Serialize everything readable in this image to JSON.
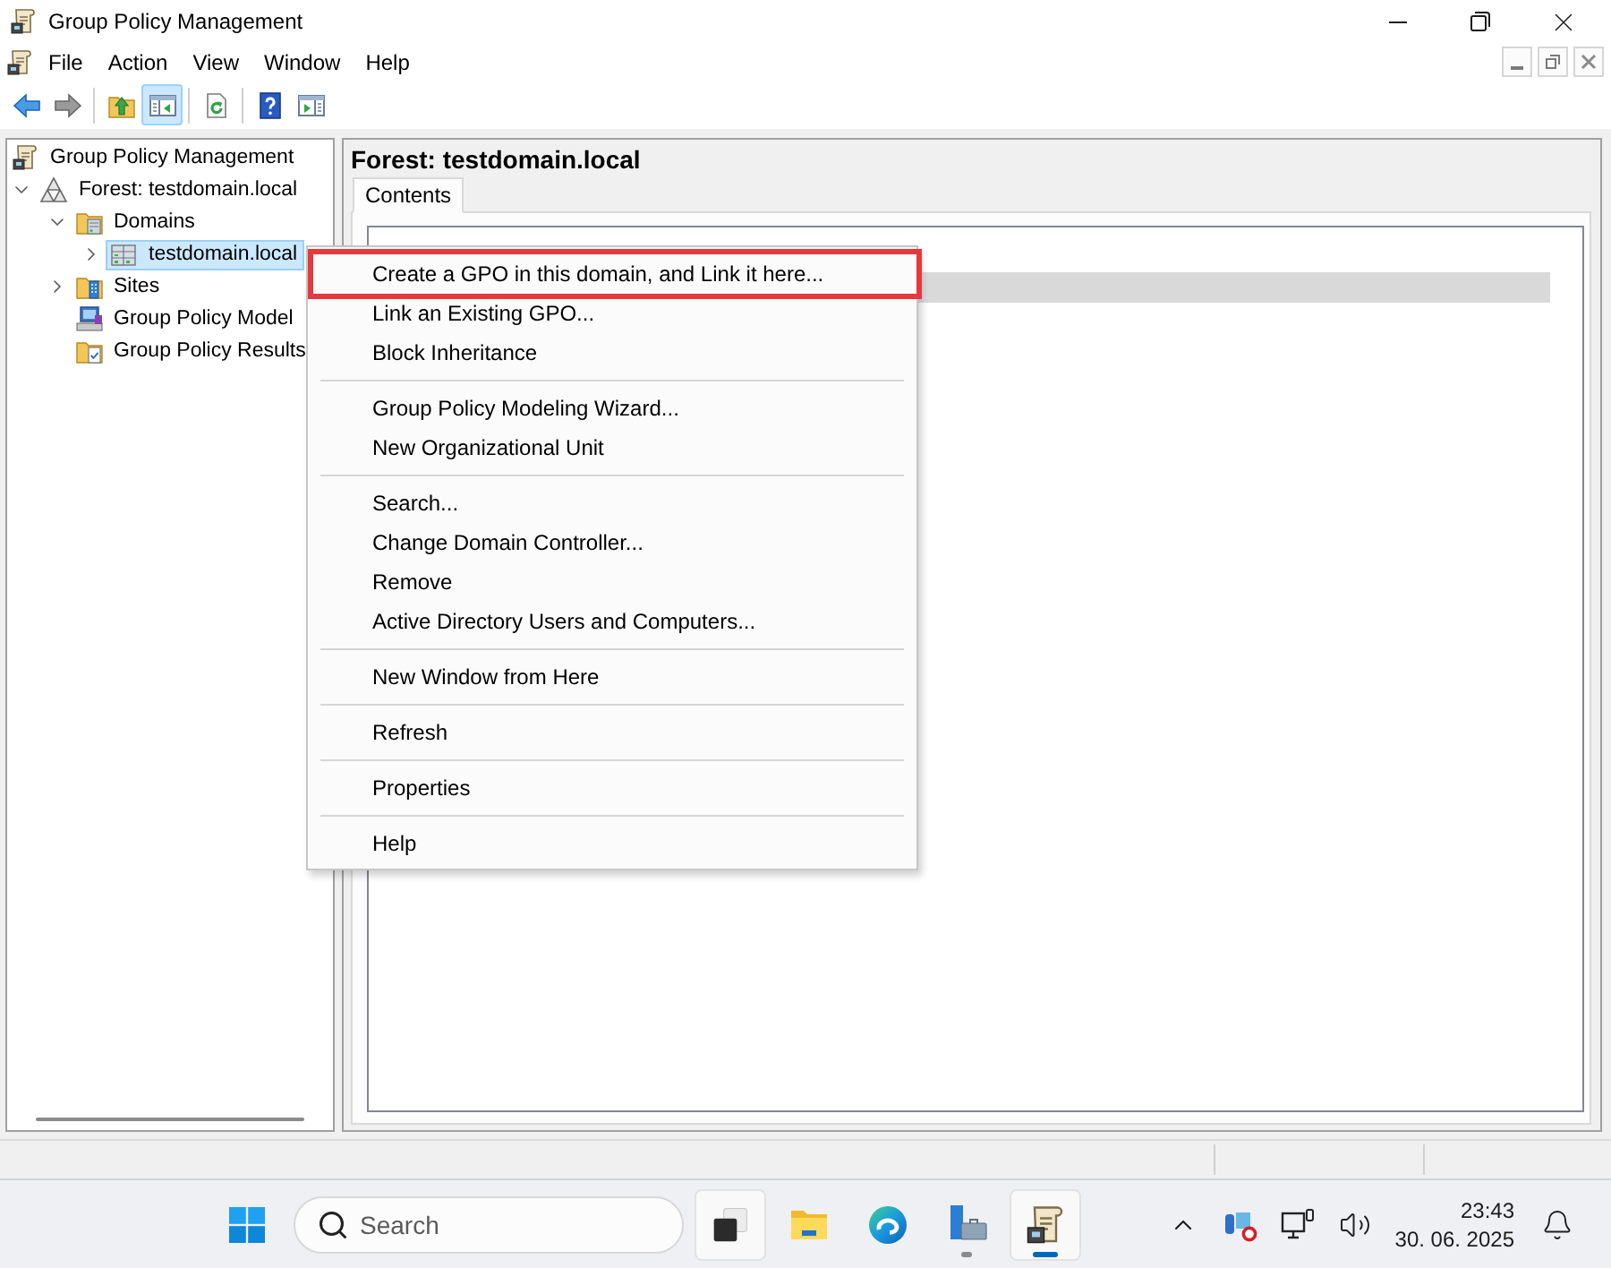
{
  "window": {
    "title": "Group Policy Management"
  },
  "menu_bar": {
    "items": [
      "File",
      "Action",
      "View",
      "Window",
      "Help"
    ]
  },
  "toolbar": {
    "groups": [
      [
        {
          "kind": "back",
          "pressed": false
        },
        {
          "kind": "forward",
          "pressed": false
        }
      ],
      [
        {
          "kind": "up-folder",
          "pressed": false
        },
        {
          "kind": "console-tree",
          "pressed": true
        }
      ],
      [
        {
          "kind": "refresh",
          "pressed": false
        }
      ],
      [
        {
          "kind": "help",
          "pressed": false
        },
        {
          "kind": "action-pane",
          "pressed": false
        }
      ]
    ]
  },
  "tree": {
    "items": [
      {
        "kind": "console",
        "label": "Group Policy Management",
        "selected": false,
        "children": [
          {
            "kind": "forest",
            "label": "Forest: testdomain.local",
            "expanded": true,
            "selected": false,
            "children": [
              {
                "kind": "domains",
                "label": "Domains",
                "expanded": true,
                "selected": false,
                "children": [
                  {
                    "kind": "domain",
                    "label": "testdomain.local",
                    "expanded": false,
                    "selected": true
                  }
                ]
              },
              {
                "kind": "sites",
                "label": "Sites",
                "expanded": false,
                "selected": false
              },
              {
                "kind": "modeling",
                "label": "Group Policy Model",
                "selected": false
              },
              {
                "kind": "results",
                "label": "Group Policy Results",
                "selected": false
              }
            ]
          }
        ]
      }
    ]
  },
  "details": {
    "title": "Forest: testdomain.local",
    "tabs": [
      {
        "label": "Contents",
        "selected": true
      }
    ],
    "list": {
      "rows": [
        {
          "selected": true
        }
      ]
    }
  },
  "context_menu": {
    "items": [
      {
        "kind": "item",
        "label": "Create a GPO in this domain, and Link it here...",
        "marked": true
      },
      {
        "kind": "item",
        "label": "Link an Existing GPO...",
        "marked": false
      },
      {
        "kind": "item",
        "label": "Block Inheritance",
        "marked": false
      },
      {
        "kind": "separator"
      },
      {
        "kind": "item",
        "label": "Group Policy Modeling Wizard...",
        "marked": false
      },
      {
        "kind": "item",
        "label": "New Organizational Unit",
        "marked": false
      },
      {
        "kind": "separator"
      },
      {
        "kind": "item",
        "label": "Search...",
        "marked": false
      },
      {
        "kind": "item",
        "label": "Change Domain Controller...",
        "marked": false
      },
      {
        "kind": "item",
        "label": "Remove",
        "marked": false
      },
      {
        "kind": "item",
        "label": "Active Directory Users and Computers...",
        "marked": false
      },
      {
        "kind": "separator"
      },
      {
        "kind": "item",
        "label": "New Window from Here",
        "marked": false
      },
      {
        "kind": "separator"
      },
      {
        "kind": "item",
        "label": "Refresh",
        "marked": false
      },
      {
        "kind": "separator"
      },
      {
        "kind": "item",
        "label": "Properties",
        "marked": false
      },
      {
        "kind": "separator"
      },
      {
        "kind": "item",
        "label": "Help",
        "marked": false
      }
    ]
  },
  "taskbar": {
    "search": {
      "placeholder": "Search"
    },
    "apps": [
      {
        "kind": "task-view",
        "highlighted": true,
        "running": false
      },
      {
        "kind": "file-explorer",
        "highlighted": false,
        "running": false
      },
      {
        "kind": "browser",
        "highlighted": false,
        "running": false
      },
      {
        "kind": "server-manager",
        "highlighted": false,
        "running": true
      },
      {
        "kind": "policy-console",
        "highlighted": true,
        "running": true
      }
    ],
    "clock": {
      "time": "23:43",
      "date": "30. 06. 2025"
    }
  }
}
